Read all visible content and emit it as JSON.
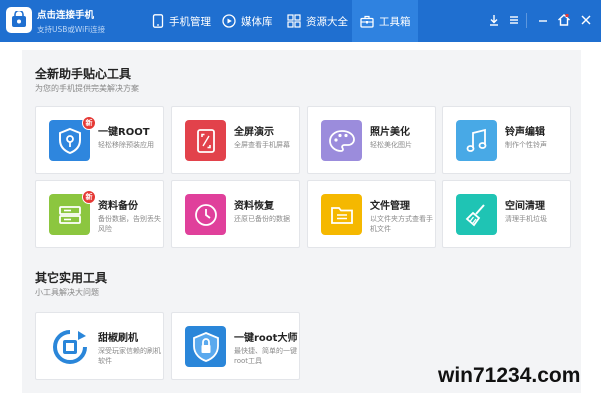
{
  "app": {
    "title": "点击连接手机",
    "subtitle": "支持USB或WiFi连接"
  },
  "nav": {
    "tabs": [
      {
        "label": "手机管理",
        "icon": "phone-icon"
      },
      {
        "label": "媒体库",
        "icon": "play-icon"
      },
      {
        "label": "资源大全",
        "icon": "grid-icon"
      },
      {
        "label": "工具箱",
        "icon": "toolbox-icon",
        "active": true
      }
    ]
  },
  "window_controls": [
    "download-icon",
    "menu-icon",
    "minimize-icon",
    "home-icon",
    "close-icon"
  ],
  "sections": [
    {
      "title": "全新助手贴心工具",
      "subtitle": "为您的手机提供完美解决方案",
      "tools": [
        {
          "name": "一键ROOT",
          "desc": "轻松移除预装应用",
          "badge": "新",
          "color": "#2e86de",
          "icon": "shield-key-icon"
        },
        {
          "name": "全屏演示",
          "desc": "全屏查看手机屏幕",
          "color": "#e2424b",
          "icon": "fullscreen-icon"
        },
        {
          "name": "照片美化",
          "desc": "轻松美化图片",
          "color": "#9b8cdc",
          "icon": "palette-icon"
        },
        {
          "name": "铃声编辑",
          "desc": "制作个性铃声",
          "color": "#48a9e6",
          "icon": "music-note-icon"
        },
        {
          "name": "资料备份",
          "desc": "备份数据，告别丢失风险",
          "badge": "新",
          "color": "#8cc63f",
          "icon": "backup-drive-icon"
        },
        {
          "name": "资料恢复",
          "desc": "还原已备份的数据",
          "color": "#e0409b",
          "icon": "clock-restore-icon"
        },
        {
          "name": "文件管理",
          "desc": "以文件夹方式查看手机文件",
          "color": "#f5b800",
          "icon": "folder-icon"
        },
        {
          "name": "空间清理",
          "desc": "清理手机垃圾",
          "color": "#1fc4b4",
          "icon": "broom-icon"
        }
      ]
    },
    {
      "title": "其它实用工具",
      "subtitle": "小工具解决大问题",
      "tools": [
        {
          "name": "甜椒刷机",
          "desc": "深受玩家信赖的刷机软件",
          "color": "#2a86d9",
          "icon": "flash-rom-icon"
        },
        {
          "name": "一键root大师",
          "desc": "最快捷、简单的一键root工具",
          "color": "#2a86d9",
          "icon": "root-master-icon"
        }
      ]
    }
  ],
  "watermark": "win71234.com"
}
